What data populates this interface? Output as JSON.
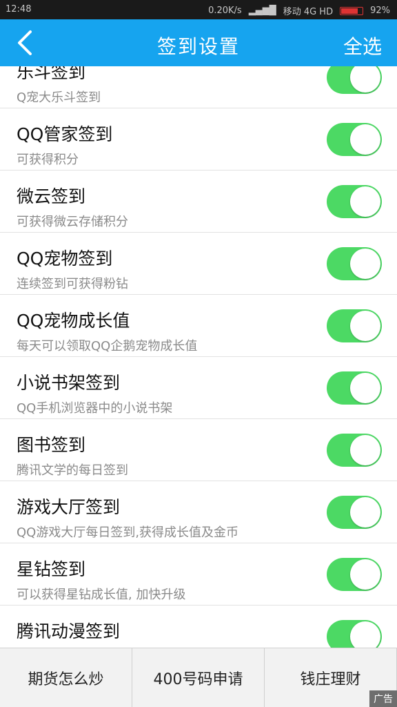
{
  "status": {
    "time": "12:48",
    "speed": "0.20K/s",
    "carrier": "移动 4G HD",
    "battery": "92%"
  },
  "header": {
    "title": "签到设置",
    "select_all": "全选"
  },
  "items": [
    {
      "name": "乐斗签到",
      "desc": "Q宠大乐斗签到",
      "enabled": true
    },
    {
      "name": "QQ管家签到",
      "desc": "可获得积分",
      "enabled": true
    },
    {
      "name": "微云签到",
      "desc": "可获得微云存储积分",
      "enabled": true
    },
    {
      "name": "QQ宠物签到",
      "desc": "连续签到可获得粉钻",
      "enabled": true
    },
    {
      "name": "QQ宠物成长值",
      "desc": "每天可以领取QQ企鹅宠物成长值",
      "enabled": true
    },
    {
      "name": "小说书架签到",
      "desc": "QQ手机浏览器中的小说书架",
      "enabled": true
    },
    {
      "name": "图书签到",
      "desc": "腾讯文学的每日签到",
      "enabled": true
    },
    {
      "name": "游戏大厅签到",
      "desc": "QQ游戏大厅每日签到,获得成长值及金币",
      "enabled": true
    },
    {
      "name": "星钻签到",
      "desc": "可以获得星钻成长值, 加快升级",
      "enabled": true
    },
    {
      "name": "腾讯动漫签到",
      "desc": "",
      "enabled": true
    }
  ],
  "bottom": {
    "buttons": [
      "期货怎么炒",
      "400号码申请",
      "钱庄理财"
    ],
    "ad_label": "广告"
  },
  "colors": {
    "header": "#16a4ef",
    "switch_on": "#4cd964"
  }
}
